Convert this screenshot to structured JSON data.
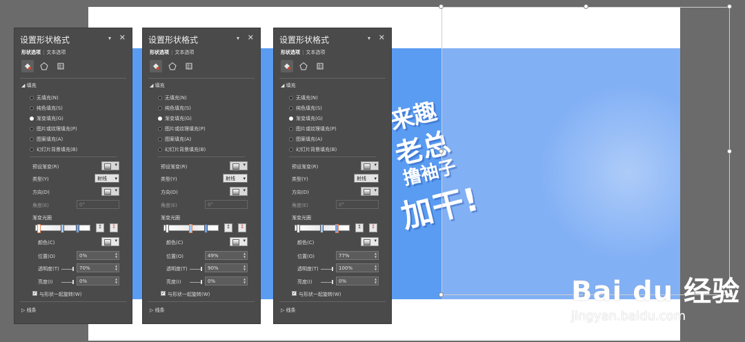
{
  "slide": {
    "headline_lines": [
      "来趣",
      "老总",
      "撸袖子",
      "加干!"
    ]
  },
  "watermark": {
    "brand_text": "Bai du 经验",
    "sub_text": "jingyan.baidu.com"
  },
  "panels": [
    {
      "title": "设置形状格式",
      "tab_shape": "形状选项",
      "tab_text": "文本选项",
      "section_fill": "填充",
      "fill_options": [
        "无填充(N)",
        "纯色填充(S)",
        "渐变填充(G)",
        "图片或纹理填充(P)",
        "图案填充(A)",
        "幻灯片背景填充(B)"
      ],
      "fill_selected": 2,
      "label_preset": "预设渐变(R)",
      "label_type": "类型(Y)",
      "type_value": "射线",
      "label_direction": "方向(D)",
      "label_angle": "角度(E)",
      "angle_value": "0°",
      "label_stops": "渐变光圈",
      "label_color": "颜色(C)",
      "label_position": "位置(O)",
      "position_value": "0%",
      "label_transparency": "透明度(T)",
      "transparency_value": "70%",
      "label_brightness": "亮度(I)",
      "brightness_value": "0%",
      "rotate_label": "与形状一起旋转(W)",
      "section_line": "线条",
      "selected_stop": 0
    },
    {
      "title": "设置形状格式",
      "tab_shape": "形状选项",
      "tab_text": "文本选项",
      "section_fill": "填充",
      "fill_options": [
        "无填充(N)",
        "纯色填充(S)",
        "渐变填充(G)",
        "图片或纹理填充(P)",
        "图案填充(A)",
        "幻灯片背景填充(B)"
      ],
      "fill_selected": 2,
      "label_preset": "预设渐变(R)",
      "label_type": "类型(Y)",
      "type_value": "射线",
      "label_direction": "方向(D)",
      "label_angle": "角度(E)",
      "angle_value": "0°",
      "label_stops": "渐变光圈",
      "label_color": "颜色(C)",
      "label_position": "位置(O)",
      "position_value": "49%",
      "label_transparency": "透明度(T)",
      "transparency_value": "90%",
      "label_brightness": "亮度(I)",
      "brightness_value": "0%",
      "rotate_label": "与形状一起旋转(W)",
      "section_line": "线条",
      "selected_stop": 1
    },
    {
      "title": "设置形状格式",
      "tab_shape": "形状选项",
      "tab_text": "文本选项",
      "section_fill": "填充",
      "fill_options": [
        "无填充(N)",
        "纯色填充(S)",
        "渐变填充(G)",
        "图片或纹理填充(P)",
        "图案填充(A)",
        "幻灯片背景填充(B)"
      ],
      "fill_selected": 2,
      "label_preset": "预设渐变(R)",
      "label_type": "类型(Y)",
      "type_value": "射线",
      "label_direction": "方向(D)",
      "label_angle": "角度(E)",
      "angle_value": "0°",
      "label_stops": "渐变光圈",
      "label_color": "颜色(C)",
      "label_position": "位置(O)",
      "position_value": "77%",
      "label_transparency": "透明度(T)",
      "transparency_value": "100%",
      "label_brightness": "亮度(I)",
      "brightness_value": "0%",
      "rotate_label": "与形状一起旋转(W)",
      "section_line": "线条",
      "selected_stop": 2
    }
  ]
}
